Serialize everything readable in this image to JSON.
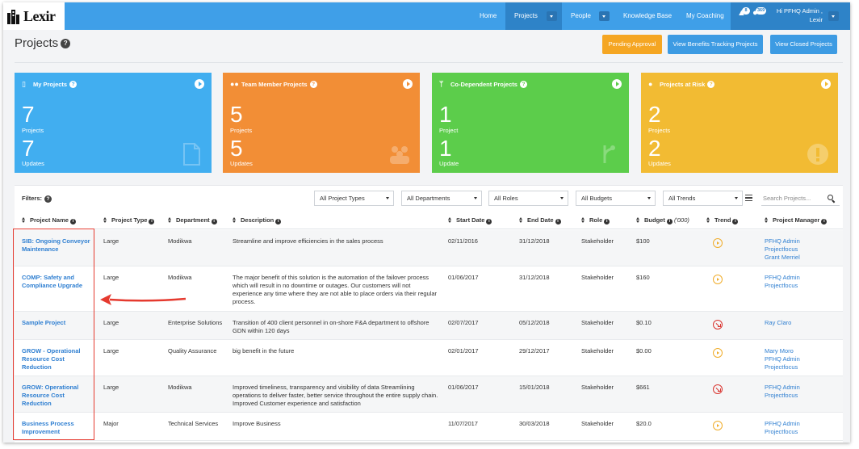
{
  "app": {
    "logo_text": "Lexir",
    "nav": {
      "home": "Home",
      "projects": "Projects",
      "people": "People",
      "knowledge_base": "Knowledge Base",
      "my_coaching": "My Coaching",
      "notif_count_1": "8",
      "notif_count_2": "369",
      "user_line1": "Hi PFHQ Admin ,",
      "user_line2": "Lexir"
    }
  },
  "header": {
    "title": "Projects",
    "help": "?",
    "buttons": {
      "pending": "Pending Approval",
      "benefits": "View Benefits Tracking Projects",
      "closed": "View Closed Projects"
    }
  },
  "cards": [
    {
      "title": "My Projects",
      "count1": "7",
      "label1": "Projects",
      "count2": "7",
      "label2": "Updates",
      "color": "#41aef0"
    },
    {
      "title": "Team Member Projects",
      "count1": "5",
      "label1": "Projects",
      "count2": "5",
      "label2": "Updates",
      "color": "#f28e36"
    },
    {
      "title": "Co-Dependent Projects",
      "count1": "1",
      "label1": "Project",
      "count2": "1",
      "label2": "Update",
      "color": "#5ccd4b"
    },
    {
      "title": "Projects at Risk",
      "count1": "2",
      "label1": "Projects",
      "count2": "2",
      "label2": "Updates",
      "color": "#f2bb33"
    }
  ],
  "filters": {
    "label": "Filters:",
    "project_types": "All Project Types",
    "departments": "All Departments",
    "roles": "All Roles",
    "budgets": "All Budgets",
    "trends": "All Trends",
    "search_placeholder": "Search Projects..."
  },
  "table": {
    "columns": {
      "name": "Project Name",
      "type": "Project Type",
      "department": "Department",
      "description": "Description",
      "start": "Start Date",
      "end": "End Date",
      "role": "Role",
      "budget": "Budget",
      "budget_unit": "('000)",
      "trend": "Trend",
      "manager": "Project Manager"
    },
    "rows": [
      {
        "name": "SIB: Ongoing Conveyor Maintenance",
        "type": "Large",
        "department": "Modikwa",
        "description": "Streamline and improve efficiencies in the sales process",
        "start": "02/11/2016",
        "end": "31/12/2018",
        "role": "Stakeholder",
        "budget": "$100",
        "trend": "right",
        "managers": [
          "PFHQ Admin",
          "Projectfocus",
          "Grant Merriel"
        ]
      },
      {
        "name": "COMP: Safety and Compliance Upgrade",
        "type": "Large",
        "department": "Modikwa",
        "description": "The major benefit of this solution is the automation of the failover process which will result in no downtime or outages. Our customers will not experience any time where they are not able to place orders via their regular process.",
        "start": "01/06/2017",
        "end": "31/12/2018",
        "role": "Stakeholder",
        "budget": "$160",
        "trend": "right",
        "managers": [
          "PFHQ Admin",
          "Projectfocus"
        ]
      },
      {
        "name": "Sample Project",
        "type": "Large",
        "department": "Enterprise Solutions",
        "description": "Transition of 400 client personnel in on-shore F&A department to offshore GDN within 120 days",
        "start": "02/07/2017",
        "end": "05/12/2018",
        "role": "Stakeholder",
        "budget": "$0.10",
        "trend": "down",
        "managers": [
          "Ray Claro"
        ]
      },
      {
        "name": "GROW - Operational Resource Cost Reduction",
        "type": "Large",
        "department": "Quality Assurance",
        "description": "big benefit in the future",
        "start": "02/01/2017",
        "end": "29/12/2017",
        "role": "Stakeholder",
        "budget": "$0.00",
        "trend": "right",
        "managers": [
          "Mary Moro",
          "PFHQ Admin",
          "Projectfocus"
        ]
      },
      {
        "name": "GROW: Operational Resource Cost Reduction",
        "type": "Large",
        "department": "Modikwa",
        "description": "Improved timeliness, transparency and visibility of data Streamlining operations to deliver faster, better service throughout the entire supply chain. Improved Customer experience and satisfaction",
        "start": "01/06/2017",
        "end": "15/01/2018",
        "role": "Stakeholder",
        "budget": "$661",
        "trend": "down",
        "managers": [
          "PFHQ Admin",
          "Projectfocus"
        ]
      },
      {
        "name": "Business Process Improvement",
        "type": "Major",
        "department": "Technical Services",
        "description": "Improve Business",
        "start": "11/07/2017",
        "end": "30/03/2018",
        "role": "Stakeholder",
        "budget": "$20.0",
        "trend": "right",
        "managers": [
          "PFHQ Admin",
          "Projectfocus"
        ]
      }
    ]
  },
  "colors": {
    "nav": "#3f9fe8",
    "nav_active": "#2e83c8",
    "pending_button": "#f5a623",
    "view_button": "#3d9be3",
    "link": "#2f7fd1",
    "annotation": "#e53a2f"
  }
}
